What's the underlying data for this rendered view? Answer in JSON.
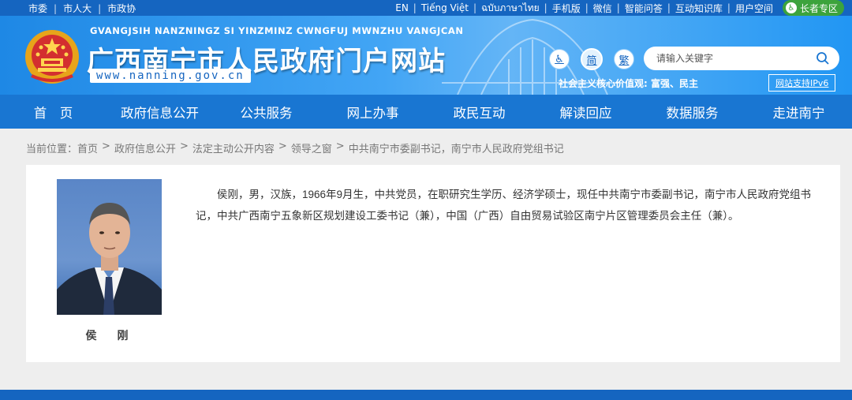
{
  "topbar": {
    "left_links": [
      "市委",
      "市人大",
      "市政协"
    ],
    "right_links": [
      "EN",
      "Tiếng Việt",
      "ฉบับภาษาไทย",
      "手机版",
      "微信",
      "智能问答",
      "互动知识库",
      "用户空间"
    ],
    "elder_label": "长者专区"
  },
  "header": {
    "pinyin": "GVANGJSIH NANZNINGZ SI YINZMINZ CWNGFUJ MWNZHU VANGJCAN",
    "title": "广西南宁市人民政府门户网站",
    "domain": "www.nanning.gov.cn",
    "accessibility_icon": "wheelchair-icon",
    "simplified_label": "简",
    "traditional_label": "繁",
    "search_placeholder": "请输入关键字",
    "core_values": "社会主义核心价值观:  富强、民主",
    "ipv6_label": "网站支持IPv6"
  },
  "nav": [
    "首　页",
    "政府信息公开",
    "公共服务",
    "网上办事",
    "政民互动",
    "解读回应",
    "数据服务",
    "走进南宁"
  ],
  "breadcrumb": {
    "prefix": "当前位置：",
    "items": [
      "首页",
      "政府信息公开",
      "法定主动公开内容",
      "领导之窗",
      "中共南宁市委副书记，南宁市人民政府党组书记"
    ]
  },
  "profile": {
    "name": "侯　刚",
    "bio": "侯刚，男，汉族，1966年9月生，中共党员，在职研究生学历、经济学硕士，现任中共南宁市委副书记，南宁市人民政府党组书记，中共广西南宁五象新区规划建设工委书记（兼），中国（广西）自由贸易试验区南宁片区管理委员会主任（兼）。"
  },
  "colors": {
    "primary": "#1976d2",
    "topbar": "#1565c0",
    "elder_green": "#3ca33c"
  }
}
